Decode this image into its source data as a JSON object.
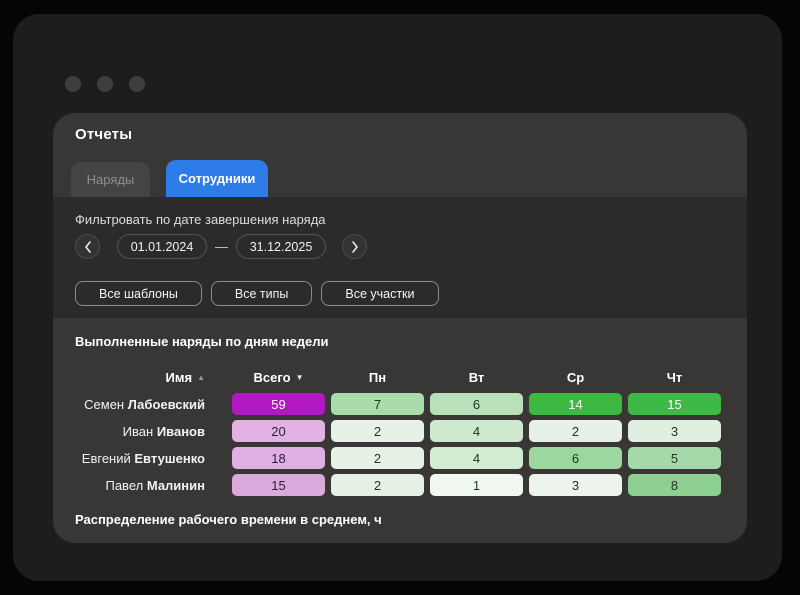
{
  "colors": {
    "accent_blue": "#2e7ce8",
    "total_max": "#b118c2",
    "day_max": "#3cb843",
    "panel_bg": "#383736",
    "filter_band_bg": "#2c2b2a",
    "window_bg": "#1e1d1c"
  },
  "icons": {
    "sort_asc": "▲",
    "sort_desc": "▼"
  },
  "panel": {
    "title": "Отчеты",
    "tabs": [
      {
        "label": "Наряды",
        "active": false
      },
      {
        "label": "Сотрудники",
        "active": true
      }
    ],
    "filter": {
      "label": "Фильтровать по дате завершения наряда",
      "date_from": "01.01.2024",
      "date_to": "31.12.2025",
      "range_separator": "—",
      "dropdowns": {
        "templates": "Все шаблоны",
        "types": "Все типы",
        "sections": "Все участки"
      }
    },
    "report": {
      "title": "Выполненные наряды по дням недели",
      "columns": {
        "name": "Имя",
        "total": "Всего",
        "days": [
          "Пн",
          "Вт",
          "Ср",
          "Чт"
        ]
      },
      "rows": [
        {
          "first": "Семен",
          "last": "Лабоевский",
          "cells": [
            {
              "v": "59",
              "bg": "#b118c2",
              "fg": "#ffffff"
            },
            {
              "v": "7",
              "bg": "#a8dcab",
              "fg": "#1e3520"
            },
            {
              "v": "6",
              "bg": "#b8e1ba",
              "fg": "#1e3520"
            },
            {
              "v": "14",
              "bg": "#3cb843",
              "fg": "#ffffff"
            },
            {
              "v": "15",
              "bg": "#3fb946",
              "fg": "#ffffff"
            }
          ]
        },
        {
          "first": "Иван",
          "last": "Иванов",
          "cells": [
            {
              "v": "20",
              "bg": "#e2b2e5",
              "fg": "#312036"
            },
            {
              "v": "2",
              "bg": "#e6f2e6",
              "fg": "#1e3520"
            },
            {
              "v": "4",
              "bg": "#cfe9d0",
              "fg": "#1e3520"
            },
            {
              "v": "2",
              "bg": "#e6f2e6",
              "fg": "#1e3520"
            },
            {
              "v": "3",
              "bg": "#dfefe0",
              "fg": "#1e3520"
            }
          ]
        },
        {
          "first": "Евгений",
          "last": "Евтушенко",
          "cells": [
            {
              "v": "18",
              "bg": "#dfaee2",
              "fg": "#312036"
            },
            {
              "v": "2",
              "bg": "#e6f2e6",
              "fg": "#1e3520"
            },
            {
              "v": "4",
              "bg": "#d2ebd3",
              "fg": "#1e3520"
            },
            {
              "v": "6",
              "bg": "#9cd7a0",
              "fg": "#1e3520"
            },
            {
              "v": "5",
              "bg": "#a6d9a9",
              "fg": "#1e3520"
            }
          ]
        },
        {
          "first": "Павел",
          "last": "Малинин",
          "cells": [
            {
              "v": "15",
              "bg": "#dca9dd",
              "fg": "#312036"
            },
            {
              "v": "2",
              "bg": "#e4f1e4",
              "fg": "#1e3520"
            },
            {
              "v": "1",
              "bg": "#f1f7f1",
              "fg": "#1e3520"
            },
            {
              "v": "3",
              "bg": "#edf3ed",
              "fg": "#1e3520"
            },
            {
              "v": "8",
              "bg": "#8ed092",
              "fg": "#1e3520"
            }
          ]
        }
      ]
    },
    "next_report_title": "Распределение рабочего времени в среднем, ч"
  }
}
